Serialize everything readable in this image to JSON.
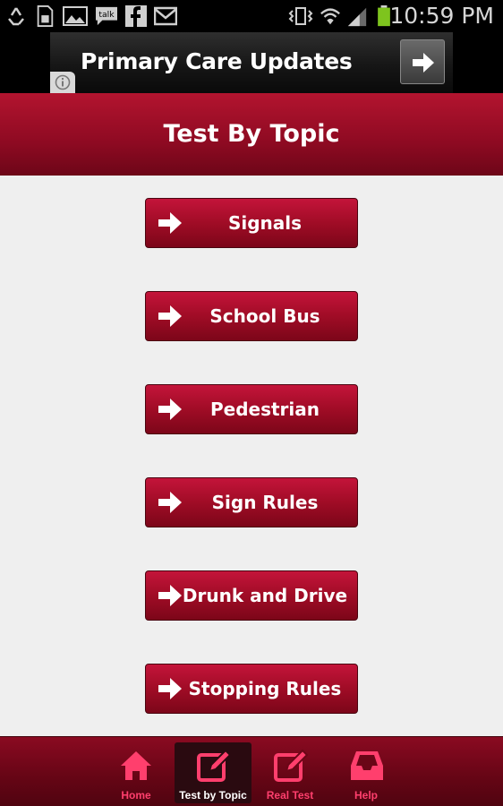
{
  "status_bar": {
    "time": "10:59 PM",
    "talk_icon_text": "talk",
    "icons": [
      "recycle-icon",
      "sim-icon",
      "gallery-icon",
      "talk-icon",
      "facebook-icon",
      "gmail-icon",
      "vibrate-icon",
      "wifi-icon",
      "signal-icon",
      "battery-icon"
    ]
  },
  "ad": {
    "title": "Primary Care Updates",
    "arrow": "arrow-right-icon",
    "info": "info-icon"
  },
  "header": {
    "title": "Test By Topic"
  },
  "topics": [
    {
      "label": "Signals"
    },
    {
      "label": "School Bus"
    },
    {
      "label": "Pedestrian"
    },
    {
      "label": "Sign Rules"
    },
    {
      "label": "Drunk and Drive"
    },
    {
      "label": "Stopping Rules"
    }
  ],
  "nav": {
    "items": [
      {
        "label": "Home",
        "icon": "home-icon"
      },
      {
        "label": "Test by Topic",
        "icon": "edit-icon",
        "active": true
      },
      {
        "label": "Real Test",
        "icon": "edit-icon"
      },
      {
        "label": "Help",
        "icon": "inbox-icon"
      }
    ]
  },
  "colors": {
    "primary": "#a00c26",
    "nav_accent": "#ff3f6d",
    "background": "#efefef"
  }
}
